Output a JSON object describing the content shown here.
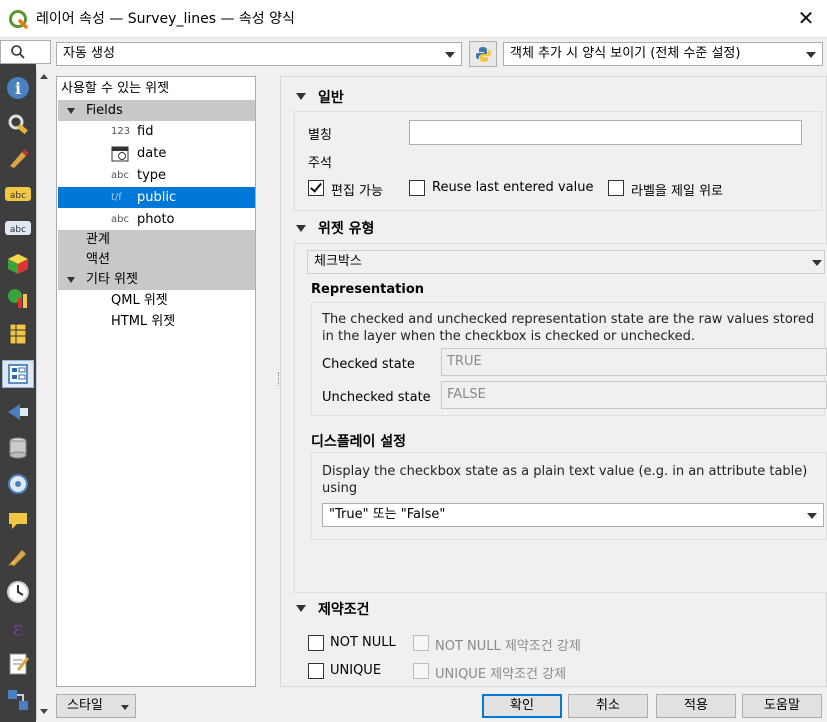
{
  "window": {
    "title": "레이어 속성 — Survey_lines — 속성 양식",
    "close_symbol": "✕"
  },
  "toolbar": {
    "search_icon": "search-icon",
    "layout_mode": "자동 생성",
    "python_icon": "python-icon",
    "form_suppress": "객체 추가 시 양식 보이기 (전체 수준 설정)"
  },
  "sidebar": {
    "icons": [
      "information-icon",
      "source-icon",
      "symbology-icon",
      "labels-icon",
      "masks-icon",
      "3d-view-icon",
      "diagrams-icon",
      "fields-icon",
      "attributes-form-icon",
      "joins-icon",
      "auxiliary-storage-icon",
      "actions-icon",
      "display-icon",
      "rendering-icon",
      "temporal-icon",
      "variables-icon",
      "metadata-icon",
      "dependencies-icon"
    ]
  },
  "tree": {
    "header": "사용할 수 있는 위젯",
    "fields_label": "Fields",
    "fields": [
      {
        "type": "123",
        "name": "fid"
      },
      {
        "type": "date",
        "name": "date"
      },
      {
        "type": "abc",
        "name": "type"
      },
      {
        "type": "t/f",
        "name": "public"
      },
      {
        "type": "abc",
        "name": "photo"
      }
    ],
    "relations": "관계",
    "actions": "액션",
    "other_widgets": "기타 위젯",
    "qml_widget": "QML 위젯",
    "html_widget": "HTML 위젯"
  },
  "general": {
    "title": "일반",
    "alias_label": "별칭",
    "alias_value": "",
    "comment_label": "주석",
    "editable": "편집 가능",
    "editable_checked": true,
    "reuse_last": "Reuse last entered value",
    "reuse_checked": false,
    "label_on_top": "라벨을 제일 위로",
    "label_on_top_checked": false
  },
  "widget_type": {
    "title": "위젯 유형",
    "selected": "체크박스",
    "representation_title": "Representation",
    "representation_desc": "The checked and unchecked representation state are the raw values stored in the layer when the checkbox is checked or unchecked.",
    "checked_label": "Checked state",
    "checked_value": "TRUE",
    "unchecked_label": "Unchecked state",
    "unchecked_value": "FALSE",
    "display_title": "디스플레이 설정",
    "display_desc": "Display the checkbox state as a plain text value (e.g. in an attribute table) using",
    "display_value": "\"True\" 또는 \"False\""
  },
  "constraints": {
    "title": "제약조건",
    "not_null": "NOT NULL",
    "not_null_enforce": "NOT NULL 제약조건 강제",
    "unique": "UNIQUE",
    "unique_enforce": "UNIQUE 제약조건 강제"
  },
  "footer": {
    "style": "스타일",
    "ok": "확인",
    "cancel": "취소",
    "apply": "적용",
    "help": "도움말"
  }
}
